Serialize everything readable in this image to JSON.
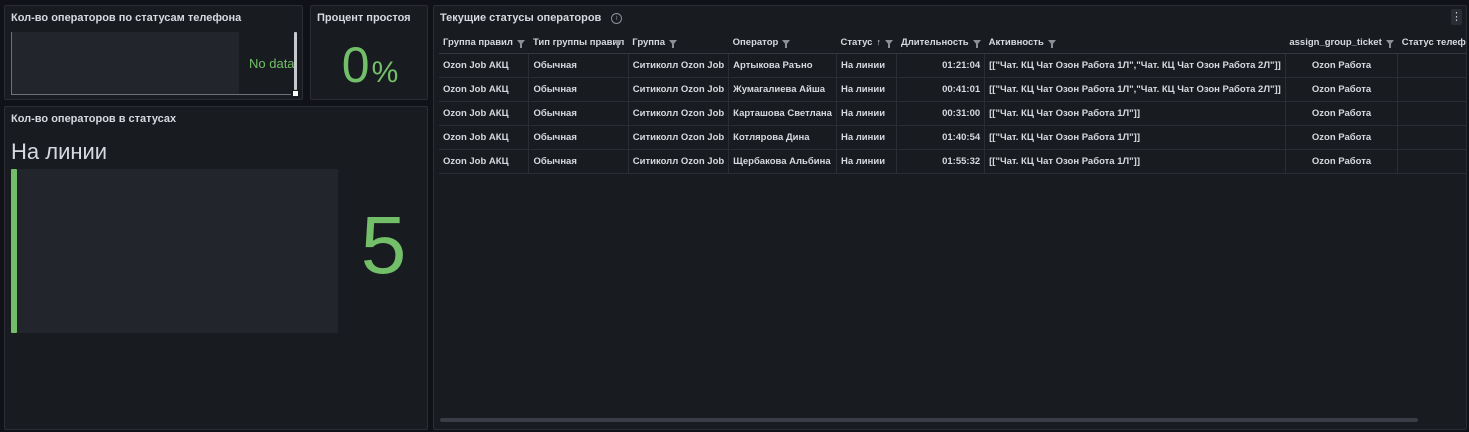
{
  "panel_phone_statuses": {
    "title": "Кол-во операторов по статусам телефона",
    "no_data": "No data"
  },
  "panel_idle_percent": {
    "title": "Процент простоя",
    "value": "0",
    "unit": "%"
  },
  "panel_operators_in_status": {
    "title": "Кол-во операторов в статусах",
    "status_name": "На линии",
    "count": "5",
    "accent_color": "#73bf69"
  },
  "panel_current_statuses": {
    "title": "Текущие статусы операторов",
    "info_icon": "info-icon",
    "menu_icon": "menu-dots-icon",
    "columns": [
      "Группа правил",
      "Тип группы правил",
      "Группа",
      "Оператор",
      "Статус",
      "Длительность",
      "Активность",
      "assign_group_ticket",
      "Статус телефона"
    ],
    "rows": [
      [
        "Ozon Job АКЦ",
        "Обычная",
        "Ситиколл Ozon Job",
        "Артыкова Раъно",
        "На линии",
        "01:21:04",
        "[[\"Чат. КЦ Чат Озон Работа 1Л\",\"Чат. КЦ Чат Озон Работа 2Л\"]]",
        "Ozon Работа",
        ""
      ],
      [
        "Ozon Job АКЦ",
        "Обычная",
        "Ситиколл Ozon Job",
        "Жумагалиева Айша",
        "На линии",
        "00:41:01",
        "[[\"Чат. КЦ Чат Озон Работа 1Л\",\"Чат. КЦ Чат Озон Работа 2Л\"]]",
        "Ozon Работа",
        ""
      ],
      [
        "Ozon Job АКЦ",
        "Обычная",
        "Ситиколл Ozon Job",
        "Карташова Светлана",
        "На линии",
        "00:31:00",
        "[[\"Чат. КЦ Чат Озон Работа 1Л\"]]",
        "Ozon Работа",
        ""
      ],
      [
        "Ozon Job АКЦ",
        "Обычная",
        "Ситиколл Ozon Job",
        "Котлярова Дина",
        "На линии",
        "01:40:54",
        "[[\"Чат. КЦ Чат Озон Работа 1Л\"]]",
        "Ozon Работа",
        ""
      ],
      [
        "Ozon Job АКЦ",
        "Обычная",
        "Ситиколл Ozon Job",
        "Щербакова Альбина",
        "На линии",
        "01:55:32",
        "[[\"Чат. КЦ Чат Озон Работа 1Л\"]]",
        "Ozon Работа",
        ""
      ]
    ]
  }
}
